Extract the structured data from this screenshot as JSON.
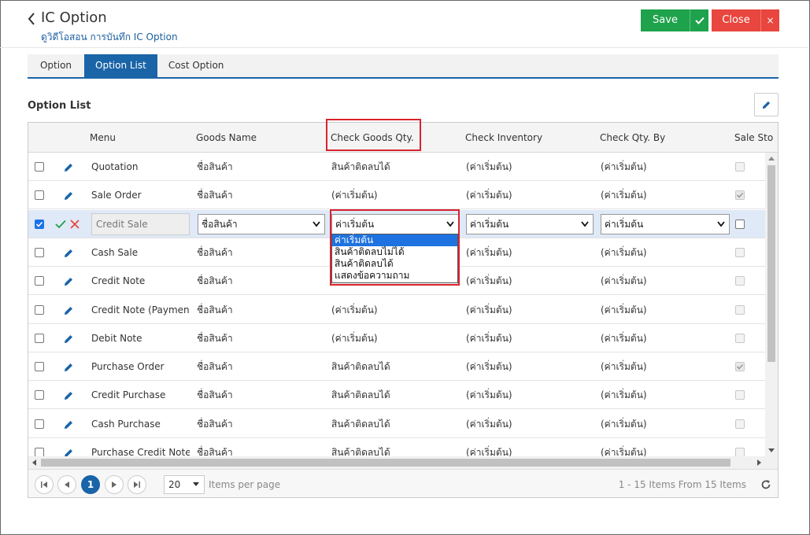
{
  "header": {
    "title": "IC Option",
    "subtitle": "ดูวิดีโอสอน การบันทึก IC Option",
    "save_label": "Save",
    "close_label": "Close",
    "close_icon": "×"
  },
  "tabs": [
    {
      "label": "Option",
      "active": false
    },
    {
      "label": "Option List",
      "active": true
    },
    {
      "label": "Cost Option",
      "active": false
    }
  ],
  "section": {
    "title": "Option List"
  },
  "columns": [
    "Menu",
    "Goods Name",
    "Check Goods Qty.",
    "Check Inventory",
    "Check Qty. By",
    "Sale Sto"
  ],
  "rows": [
    {
      "menu": "Quotation",
      "goods": "ชื่อสินค้า",
      "qty": "สินค้าติดลบได้",
      "inv": "(ค่าเริ่มต้น)",
      "by": "(ค่าเริ่มต้น)",
      "sale_checked": false
    },
    {
      "menu": "Sale Order",
      "goods": "ชื่อสินค้า",
      "qty": "(ค่าเริ่มต้น)",
      "inv": "(ค่าเริ่มต้น)",
      "by": "(ค่าเริ่มต้น)",
      "sale_checked": true
    },
    {
      "menu": "Credit Sale",
      "goods": "ชื่อสินค้า",
      "qty": "ค่าเริ่มต้น",
      "inv": "ค่าเริ่มต้น",
      "by": "ค่าเริ่มต้น",
      "sale_checked": false,
      "editing": true
    },
    {
      "menu": "Cash Sale",
      "goods": "ชื่อสินค้า",
      "qty": "",
      "inv": "(ค่าเริ่มต้น)",
      "by": "(ค่าเริ่มต้น)",
      "sale_checked": false
    },
    {
      "menu": "Credit Note",
      "goods": "ชื่อสินค้า",
      "qty": "",
      "inv": "(ค่าเริ่มต้น)",
      "by": "(ค่าเริ่มต้น)",
      "sale_checked": false
    },
    {
      "menu": "Credit Note (Payment)",
      "goods": "ชื่อสินค้า",
      "qty": "(ค่าเริ่มต้น)",
      "inv": "(ค่าเริ่มต้น)",
      "by": "(ค่าเริ่มต้น)",
      "sale_checked": false
    },
    {
      "menu": "Debit Note",
      "goods": "ชื่อสินค้า",
      "qty": "(ค่าเริ่มต้น)",
      "inv": "(ค่าเริ่มต้น)",
      "by": "(ค่าเริ่มต้น)",
      "sale_checked": false
    },
    {
      "menu": "Purchase Order",
      "goods": "ชื่อสินค้า",
      "qty": "สินค้าติดลบได้",
      "inv": "(ค่าเริ่มต้น)",
      "by": "(ค่าเริ่มต้น)",
      "sale_checked": true
    },
    {
      "menu": "Credit Purchase",
      "goods": "ชื่อสินค้า",
      "qty": "สินค้าติดลบได้",
      "inv": "(ค่าเริ่มต้น)",
      "by": "(ค่าเริ่มต้น)",
      "sale_checked": false
    },
    {
      "menu": "Cash Purchase",
      "goods": "ชื่อสินค้า",
      "qty": "สินค้าติดลบได้",
      "inv": "(ค่าเริ่มต้น)",
      "by": "(ค่าเริ่มต้น)",
      "sale_checked": false
    },
    {
      "menu": "Purchase Credit Note",
      "goods": "ชื่อสินค้า",
      "qty": "สินค้าติดลบได้",
      "inv": "(ค่าเริ่มต้น)",
      "by": "(ค่าเริ่มต้น)",
      "sale_checked": false
    }
  ],
  "dropdown": {
    "options": [
      "ค่าเริ่มต้น",
      "สินค้าติดลบไม่ได้",
      "สินค้าติดลบได้",
      "แสดงข้อความถาม"
    ],
    "highlighted_index": 0
  },
  "pager": {
    "current_page": "1",
    "page_size": "20",
    "page_size_label": "Items per page",
    "info": "1 - 15 Items From 15 Items"
  },
  "colors": {
    "primary": "#1a64a8",
    "save": "#1ea24c",
    "close": "#e8463e",
    "highlight_box": "#d9232e"
  }
}
